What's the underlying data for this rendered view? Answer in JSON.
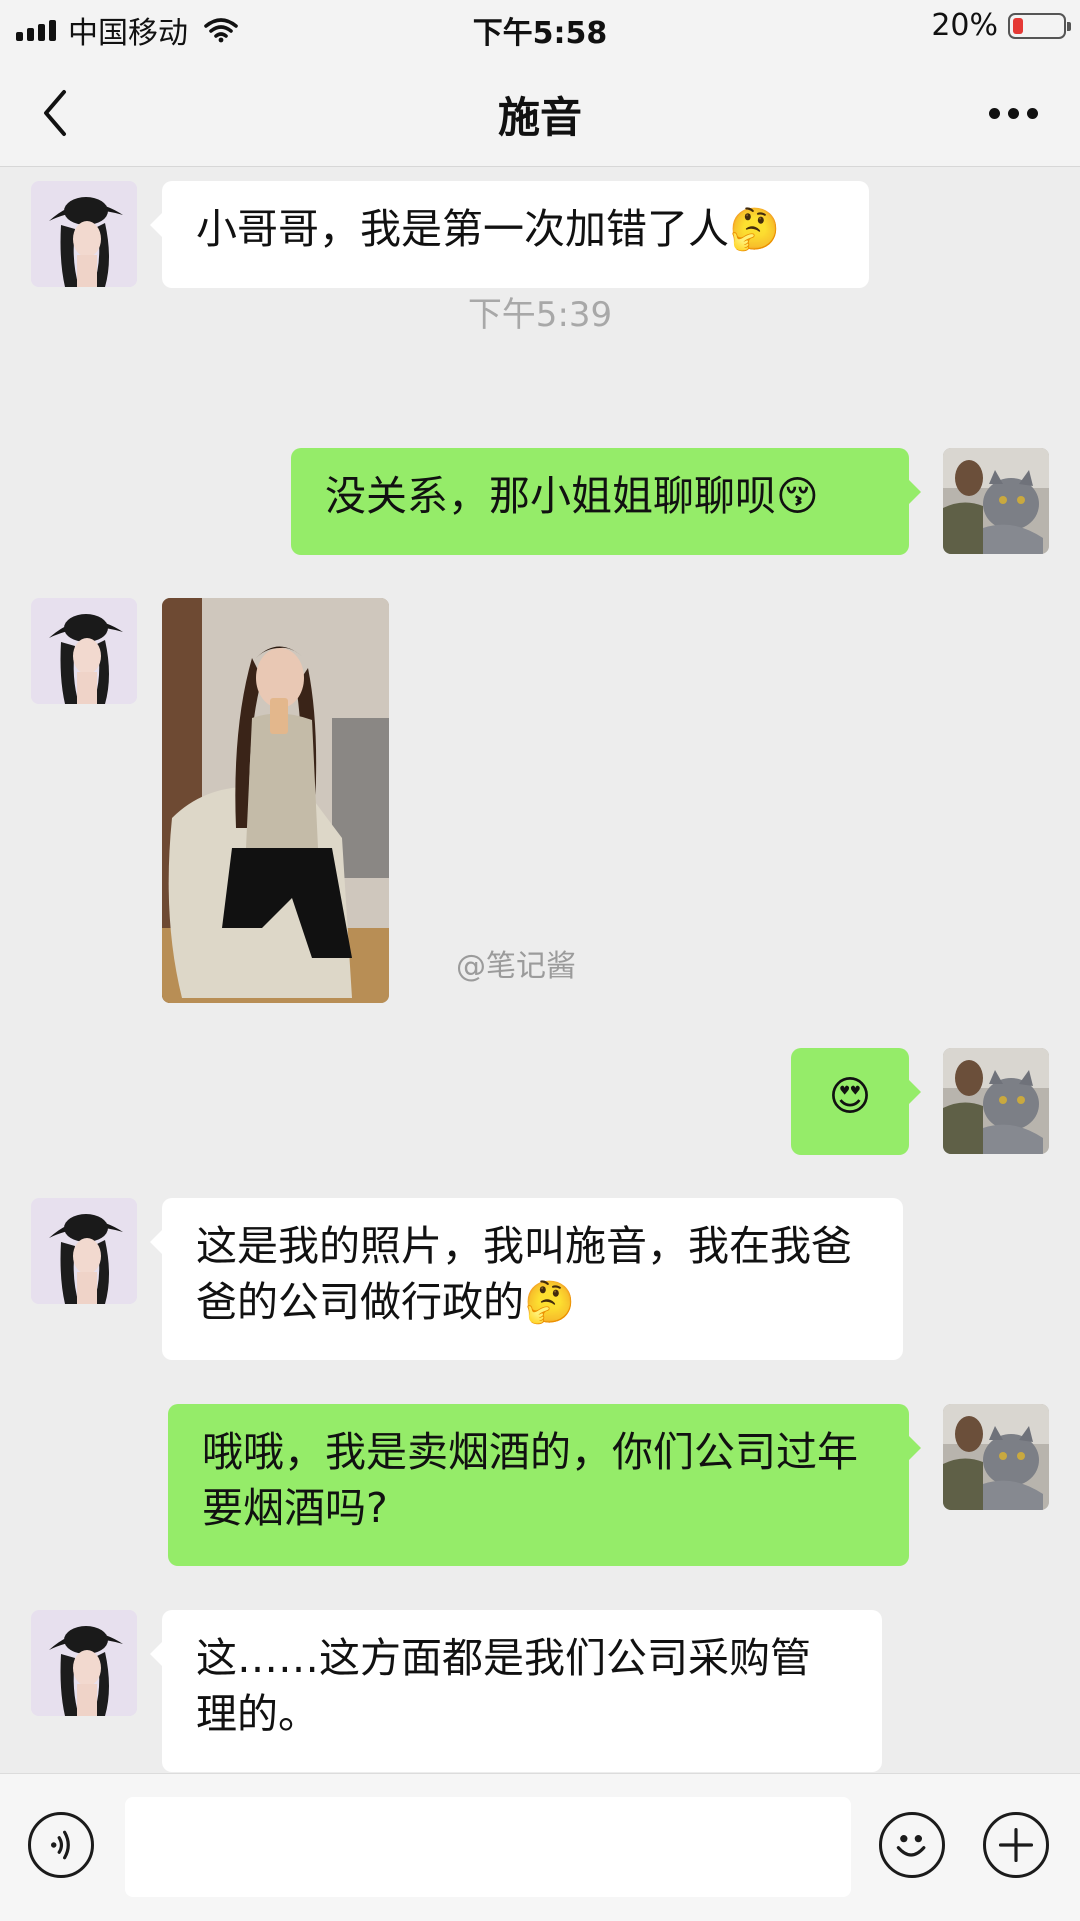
{
  "status_bar": {
    "carrier": "中国移动",
    "time": "下午5:58",
    "battery": "20%",
    "battery_level": 0.2,
    "battery_color": "#e53935"
  },
  "header": {
    "title": "施音"
  },
  "messages": [
    {
      "text": "小哥哥，我是第一次加错了人🤔"
    },
    {
      "timestamp": "下午5:39"
    },
    {
      "text": "没关系，那小姐姐聊聊呗😚"
    },
    {
      "image": "photo"
    },
    {
      "text": "😍"
    },
    {
      "text": "这是我的照片，我叫施音，我在我爸爸的公司做行政的🤔"
    },
    {
      "text": "哦哦，我是卖烟酒的，你们公司过年要烟酒吗?"
    },
    {
      "text": "这……这方面都是我们公司采购管理的。"
    }
  ],
  "watermark": "@笔记酱",
  "colors": {
    "outgoing_bubble": "#95ec69",
    "incoming_bubble": "#ffffff",
    "background": "#ededed"
  }
}
